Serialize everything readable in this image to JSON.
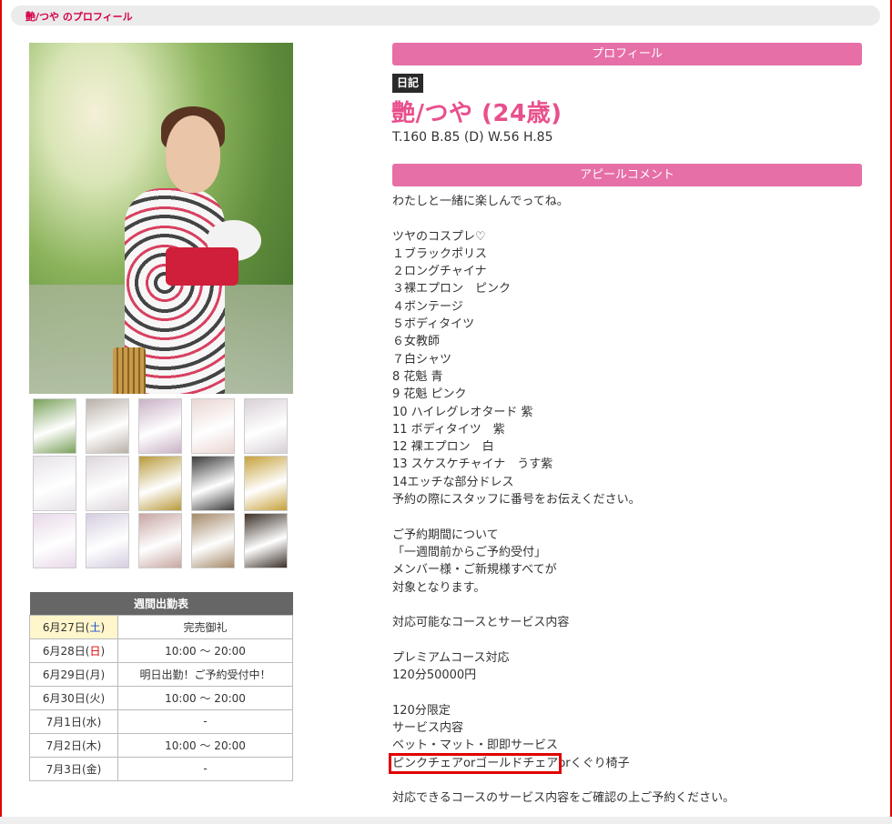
{
  "page_title": "艶/つや のプロフィール",
  "profile": {
    "section_label": "プロフィール",
    "diary_label": "日記",
    "name": "艶/つや (24歳)",
    "stats": "T.160 B.85 (D) W.56 H.85"
  },
  "appeal": {
    "section_label": "アピールコメント",
    "lines": [
      "わたしと一緒に楽しんでってね。",
      "",
      "ツヤのコスプレ♡",
      "１ブラックポリス",
      "２ロングチャイナ",
      "３裸エプロン　ピンク",
      "４ボンテージ",
      "５ボディタイツ",
      "６女教師",
      "７白シャツ",
      "8 花魁 青",
      "9 花魁 ピンク",
      "10 ハイレグレオタード 紫",
      "11 ボディタイツ　紫",
      "12 裸エプロン　白",
      "13 スケスケチャイナ　うす紫",
      "14エッチな部分ドレス",
      "予約の際にスタッフに番号をお伝えください。",
      "",
      "ご予約期間について",
      "「一週間前からご予約受付」",
      "メンバー様・ご新規様すべてが",
      "対象となります。",
      "",
      "対応可能なコースとサービス内容",
      "",
      "プレミアムコース対応",
      "120分50000円",
      "",
      "120分限定",
      "サービス内容",
      "ベット・マット・即即サービス",
      "",
      "",
      "対応できるコースのサービス内容をご確認の上ご予約ください。"
    ],
    "highlighted_text": "ピンクチェアorゴールドチェア",
    "after_highlight_text": "orくぐり椅子"
  },
  "schedule": {
    "title": "週間出勤表",
    "rows": [
      {
        "date_main": "6月27日(",
        "dow": "土",
        "date_end": ")",
        "time": "完売御礼"
      },
      {
        "date_main": "6月28日(",
        "dow": "日",
        "date_end": ")",
        "time": "10:00 ～ 20:00"
      },
      {
        "date_main": "6月29日(",
        "dow": "月",
        "date_end": ")",
        "time": "明日出勤！ご予約受付中！"
      },
      {
        "date_main": "6月30日(",
        "dow": "火",
        "date_end": ")",
        "time": "10:00 ～ 20:00"
      },
      {
        "date_main": "7月1日(",
        "dow": "水",
        "date_end": ")",
        "time": "-"
      },
      {
        "date_main": "7月2日(",
        "dow": "木",
        "date_end": ")",
        "time": "10:00 ～ 20:00"
      },
      {
        "date_main": "7月3日(",
        "dow": "金",
        "date_end": ")",
        "time": "-"
      }
    ]
  },
  "thumbnail_colors": [
    "#7aa15a",
    "#b9b0a8",
    "#c9b1c6",
    "#e9d6d2",
    "#d8d0d6",
    "#e7e2e8",
    "#ddd6dc",
    "#b89a3a",
    "#3a3a3a",
    "#c6a13a",
    "#e8d8e8",
    "#d5cde0",
    "#c7a6a2",
    "#a58a6a",
    "#3b3028"
  ],
  "colors": {
    "accent_pink": "#e66fa7",
    "name_pink": "#e8508d",
    "highlight_red": "#e00000"
  }
}
